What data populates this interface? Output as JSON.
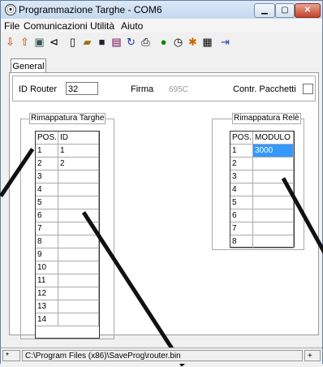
{
  "window": {
    "title": "Programmazione Targhe - COM6"
  },
  "menu": [
    "File",
    "Comunicazioni",
    "Utilità",
    "Aiuto"
  ],
  "tab": "General",
  "header": {
    "id_router_label": "ID Router",
    "id_router_value": "32",
    "firma_label": "Firma",
    "firma_value": "695C",
    "contr_label": "Contr. Pacchetti"
  },
  "targhe": {
    "legend": "Rimappatura Targhe",
    "col_pos": "POS.",
    "col_id": "ID",
    "rows": [
      {
        "pos": "1",
        "id": "1"
      },
      {
        "pos": "2",
        "id": "2"
      },
      {
        "pos": "3",
        "id": ""
      },
      {
        "pos": "4",
        "id": ""
      },
      {
        "pos": "5",
        "id": ""
      },
      {
        "pos": "6",
        "id": ""
      },
      {
        "pos": "7",
        "id": ""
      },
      {
        "pos": "8",
        "id": ""
      },
      {
        "pos": "9",
        "id": ""
      },
      {
        "pos": "10",
        "id": ""
      },
      {
        "pos": "11",
        "id": ""
      },
      {
        "pos": "12",
        "id": ""
      },
      {
        "pos": "13",
        "id": ""
      },
      {
        "pos": "14",
        "id": ""
      }
    ]
  },
  "rele": {
    "legend": "Rimappatura Relè",
    "col_pos": "POS.",
    "col_modulo": "MODULO",
    "rows": [
      {
        "pos": "1",
        "modulo": "3000"
      },
      {
        "pos": "2",
        "modulo": ""
      },
      {
        "pos": "3",
        "modulo": ""
      },
      {
        "pos": "4",
        "modulo": ""
      },
      {
        "pos": "5",
        "modulo": ""
      },
      {
        "pos": "6",
        "modulo": ""
      },
      {
        "pos": "7",
        "modulo": ""
      },
      {
        "pos": "8",
        "modulo": ""
      }
    ]
  },
  "status": {
    "star": "*",
    "path": "C:\\Program Files (x86)\\SaveProg\\router.bin",
    "plus": "+"
  },
  "colors": {
    "selection": "#3399ff",
    "titlebar": "#c4d8ef"
  }
}
